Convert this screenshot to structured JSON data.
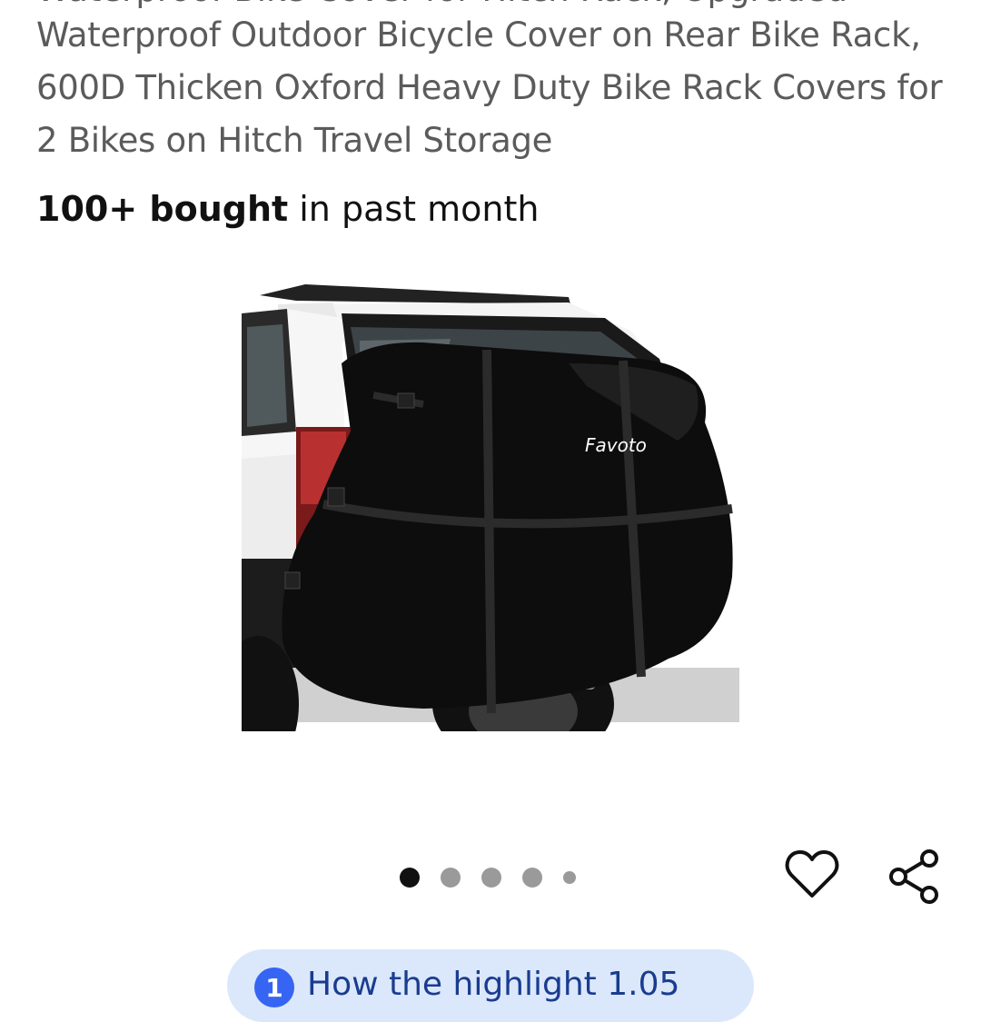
{
  "listing": {
    "title_hidden_prev_line": "Waterproof Bike Cover for Hitch Rack, Upgraded",
    "title": "Waterproof Outdoor Bicycle Cover on Rear Bike Rack, 600D Thicken Oxford Heavy Duty Bike Rack Covers for 2 Bikes on Hitch Travel Storage",
    "bought_strong": "100+ bought",
    "bought_rest": " in past month",
    "brand_on_image": "Favoto"
  },
  "gallery": {
    "dot_count": 5,
    "active_index": 0
  },
  "actions": {
    "watch_icon": "heart-outline-icon",
    "share_icon": "share-icon"
  },
  "highlight": {
    "badge": "1",
    "text": "How the highlight 1.05"
  },
  "colors": {
    "title": "#5b5b5b",
    "dot_active": "#111111",
    "dot_inactive": "#9a9a9a",
    "pill_bg": "#dbe8fb",
    "pill_badge": "#3665f3"
  }
}
